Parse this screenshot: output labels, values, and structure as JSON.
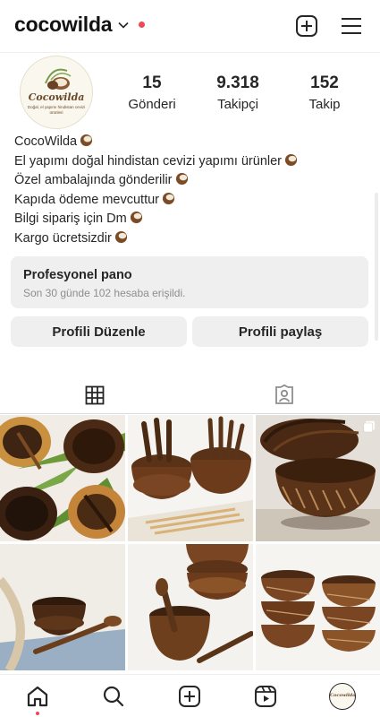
{
  "header": {
    "username": "cocowilda"
  },
  "profile": {
    "avatar_brand": "Cocowilda",
    "avatar_tagline": "Doğal, el yapımı hindistan cevizi ürünleri",
    "stats": [
      {
        "value": "15",
        "label": "Gönderi"
      },
      {
        "value": "9.318",
        "label": "Takipçi"
      },
      {
        "value": "152",
        "label": "Takip"
      }
    ],
    "bio": {
      "name": "CocoWilda",
      "lines": [
        "El yapımı doğal hindistan cevizi yapımı ürünler",
        "Özel ambalajında gönderilir",
        "Kapıda ödeme mevcuttur",
        "Bilgi sipariş için Dm",
        "Kargo ücretsizdir"
      ]
    }
  },
  "dashboard": {
    "title": "Profesyonel pano",
    "subtitle": "Son 30 günde 102 hesaba erişildi."
  },
  "actions": {
    "edit_label": "Profili Düzenle",
    "share_label": "Profili paylaş"
  },
  "tabs": [
    {
      "icon": "grid-icon",
      "active": true
    },
    {
      "icon": "tagged-person-icon",
      "active": false
    }
  ],
  "posts": [
    {
      "icon": "photo-coconut-bowls-leaves"
    },
    {
      "icon": "photo-coconut-cutlery-bowls"
    },
    {
      "icon": "photo-carved-coconut-bowls",
      "multi": true
    },
    {
      "icon": "photo-bowl-with-spoon"
    },
    {
      "icon": "photo-stacked-bowls-spoons"
    },
    {
      "icon": "photo-engraved-bowl-stacks"
    }
  ],
  "bottom_nav": [
    {
      "icon": "home-icon",
      "active": true
    },
    {
      "icon": "search-icon"
    },
    {
      "icon": "create-post-icon"
    },
    {
      "icon": "reels-icon"
    },
    {
      "icon": "profile-avatar"
    }
  ],
  "colors": {
    "notification_red": "#ed4956",
    "button_bg": "#efefef",
    "text_primary": "#262626",
    "text_secondary": "#8e8e8e"
  }
}
